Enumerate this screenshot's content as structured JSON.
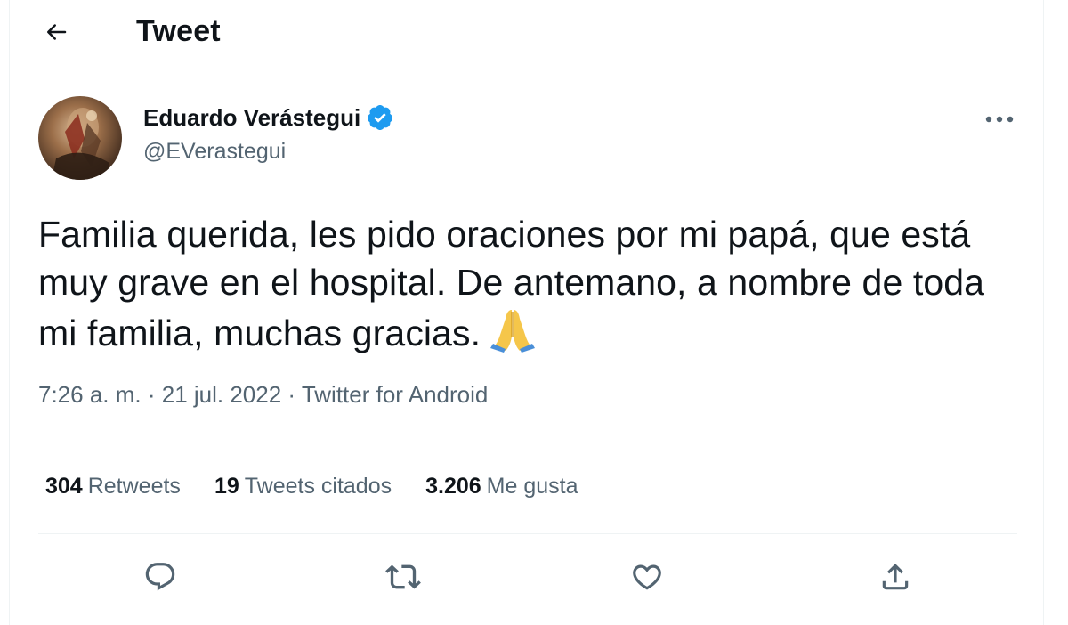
{
  "header": {
    "title": "Tweet",
    "back_icon": "arrow-left-icon"
  },
  "author": {
    "display_name": "Eduardo Verástegui",
    "handle": "@EVerastegui",
    "verified": true,
    "verified_color": "#1d9bf0"
  },
  "tweet": {
    "text": "Familia querida, les pido oraciones por mi papá, que está muy grave en el hospital. De antemano, a nombre de toda mi familia, muchas gracias.",
    "emoji": "folded-hands-icon",
    "time": "7:26 a. m.",
    "separator": " · ",
    "date": "21 jul. 2022",
    "source": "Twitter for Android"
  },
  "stats": [
    {
      "count": "304",
      "label": "Retweets"
    },
    {
      "count": "19",
      "label": "Tweets citados"
    },
    {
      "count": "3.206",
      "label": "Me gusta"
    }
  ],
  "actions": [
    "reply-icon",
    "retweet-icon",
    "like-icon",
    "share-icon"
  ],
  "colors": {
    "text_primary": "#0f1419",
    "text_secondary": "#536471",
    "divider": "#eff3f4",
    "accent": "#1d9bf0"
  }
}
